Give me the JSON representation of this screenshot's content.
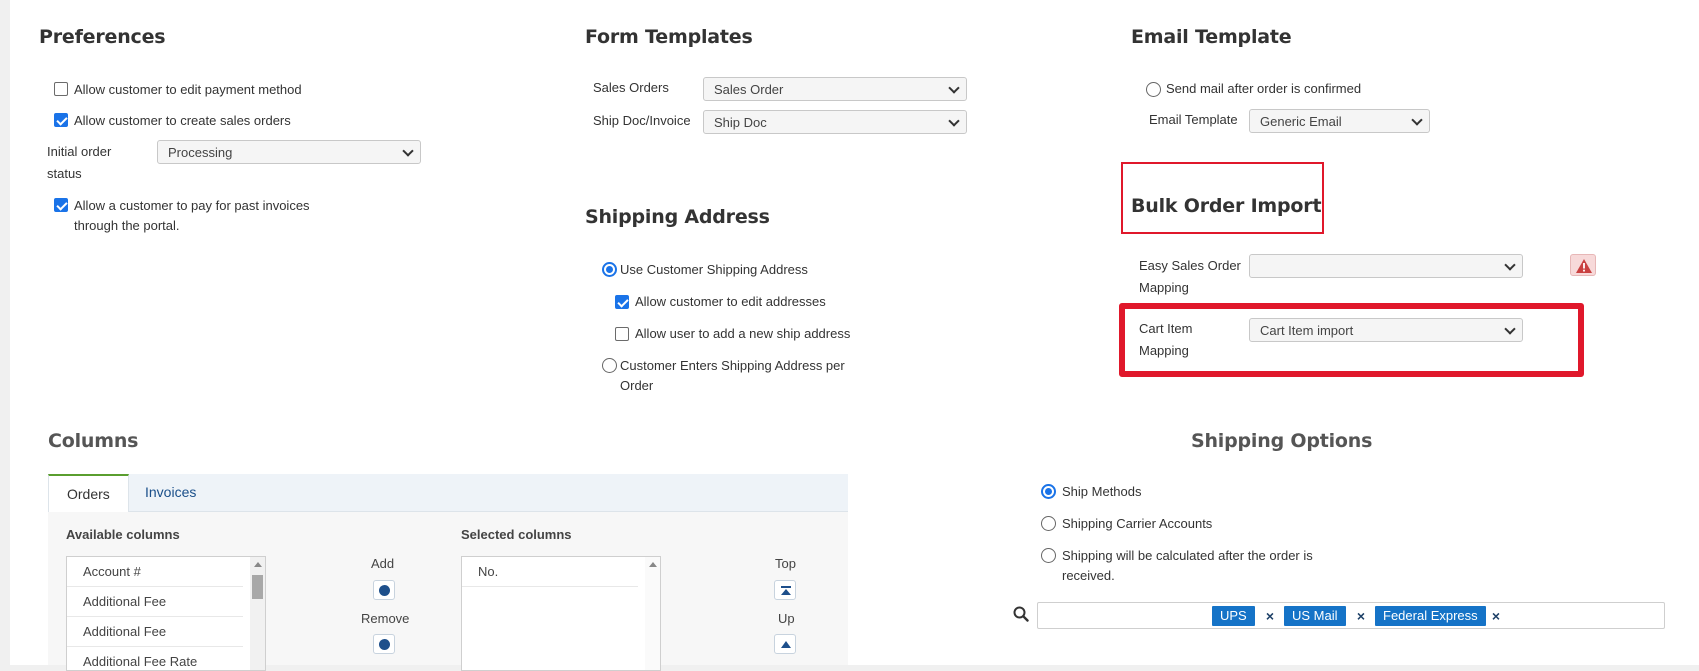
{
  "preferences": {
    "title": "Preferences",
    "allow_edit_payment": "Allow customer to edit payment method",
    "allow_create_orders": "Allow customer to create sales orders",
    "initial_status_label_1": "Initial order",
    "initial_status_label_2": "status",
    "initial_status_value": "Processing",
    "allow_pay_past_1": "Allow a customer to pay for past invoices",
    "allow_pay_past_2": "through the portal."
  },
  "form_templates": {
    "title": "Form Templates",
    "sales_orders_label": "Sales Orders",
    "sales_orders_value": "Sales Order",
    "ship_doc_label": "Ship Doc/Invoice",
    "ship_doc_value": "Ship Doc"
  },
  "email_template": {
    "title": "Email Template",
    "send_mail_label": "Send mail after order is confirmed",
    "template_label": "Email Template",
    "template_value": "Generic Email"
  },
  "shipping_address": {
    "title": "Shipping Address",
    "use_customer": "Use Customer Shipping Address",
    "allow_edit": "Allow customer to edit addresses",
    "allow_new": "Allow user to add a new ship address",
    "per_order_1": "Customer Enters Shipping Address per",
    "per_order_2": "Order"
  },
  "bulk_import": {
    "title": "Bulk Order Import",
    "easy_label_1": "Easy Sales Order",
    "easy_label_2": "Mapping",
    "easy_value": "",
    "cart_label_1": "Cart Item",
    "cart_label_2": "Mapping",
    "cart_value": "Cart Item import"
  },
  "columns": {
    "title": "Columns",
    "tabs": [
      "Orders",
      "Invoices"
    ],
    "available_label": "Available columns",
    "selected_label": "Selected columns",
    "available": [
      "Account #",
      "Additional Fee",
      "Additional Fee",
      "Additional Fee Rate"
    ],
    "selected": [
      "No."
    ],
    "add_label": "Add",
    "remove_label": "Remove",
    "top_label": "Top",
    "up_label": "Up"
  },
  "shipping_options": {
    "title": "Shipping Options",
    "ship_methods": "Ship Methods",
    "carrier_accounts": "Shipping Carrier Accounts",
    "calculated_1": "Shipping will be calculated after the order is",
    "calculated_2": "received.",
    "tags": [
      "UPS",
      "US Mail",
      "Federal Express"
    ],
    "tag_remove": "×"
  },
  "colors": {
    "accent": "#1a73e8",
    "tag_blue": "#1573c7",
    "highlight_red": "#e0182b",
    "warning_red": "#c94040",
    "tab_green": "#5a9e2f"
  }
}
